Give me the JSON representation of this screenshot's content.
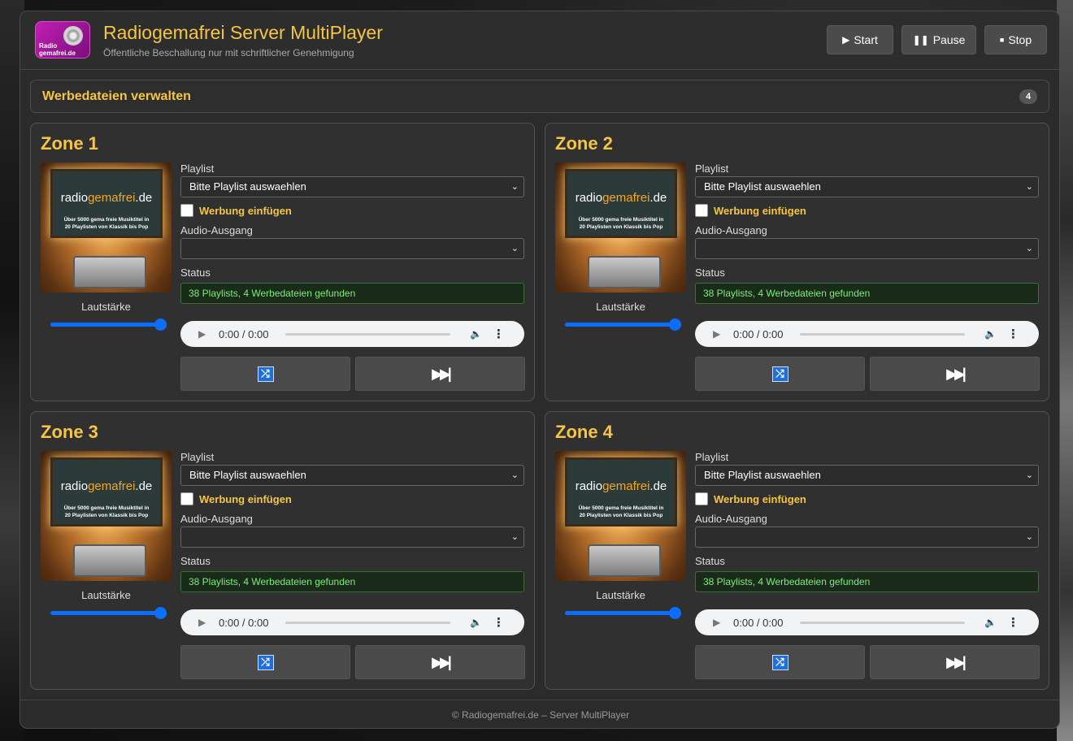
{
  "header": {
    "title": "Radiogemafrei Server MultiPlayer",
    "subtitle": "Öffentliche Beschallung nur mit schriftlicher Genehmigung",
    "logo_text_top": "Radio",
    "logo_text_bottom": "gemafrei.de",
    "buttons": {
      "start": {
        "icon": "play-icon",
        "glyph": "▶",
        "label": "Start"
      },
      "pause": {
        "icon": "pause-icon",
        "glyph": "❚❚",
        "label": "Pause"
      },
      "stop": {
        "icon": "stop-icon",
        "glyph": "■",
        "label": "Stop"
      }
    }
  },
  "ads": {
    "title": "Werbedateien verwalten",
    "count": "4"
  },
  "zone_labels": {
    "playlist": "Playlist",
    "insert_ads": "Werbung einfügen",
    "audio_output": "Audio-Ausgang",
    "status": "Status",
    "volume": "Lautstärke"
  },
  "cover": {
    "brand_a": "radio",
    "brand_b": "gemafrei",
    "brand_c": ".de",
    "line1": "Über 5000 gema freie Musiktitel in",
    "line2": "20 Playlisten von Klassik bis Pop"
  },
  "zones": [
    {
      "title": "Zone 1",
      "playlist": "Bitte Playlist auswaehlen",
      "audio_output": "",
      "insert_ads": false,
      "status": "38 Playlists, 4 Werbedateien gefunden",
      "volume": 1.0,
      "time": "0:00 / 0:00"
    },
    {
      "title": "Zone 2",
      "playlist": "Bitte Playlist auswaehlen",
      "audio_output": "",
      "insert_ads": false,
      "status": "38 Playlists, 4 Werbedateien gefunden",
      "volume": 1.0,
      "time": "0:00 / 0:00"
    },
    {
      "title": "Zone 3",
      "playlist": "Bitte Playlist auswaehlen",
      "audio_output": "",
      "insert_ads": false,
      "status": "38 Playlists, 4 Werbedateien gefunden",
      "volume": 1.0,
      "time": "0:00 / 0:00"
    },
    {
      "title": "Zone 4",
      "playlist": "Bitte Playlist auswaehlen",
      "audio_output": "",
      "insert_ads": false,
      "status": "38 Playlists, 4 Werbedateien gefunden",
      "volume": 1.0,
      "time": "0:00 / 0:00"
    }
  ],
  "footer": {
    "text": "© Radiogemafrei.de – Server MultiPlayer"
  },
  "colors": {
    "accent": "#f5c543",
    "slider": "#0d6efd",
    "status_text": "#7bed7b"
  }
}
